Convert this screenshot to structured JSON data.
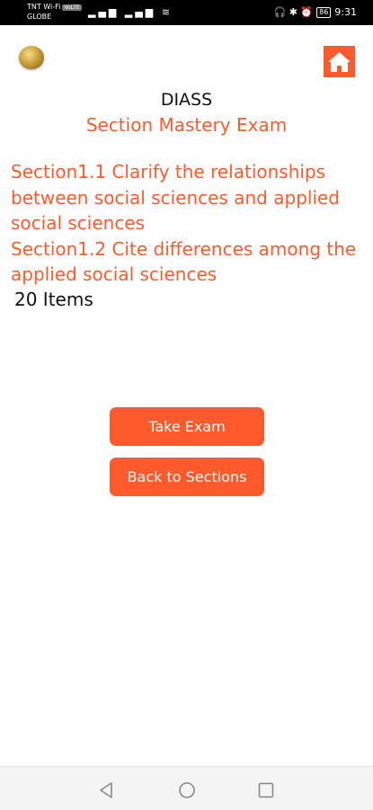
{
  "status_bar": {
    "carrier_line1": "TNT Wi-Fi",
    "carrier_badge": "VoLTE",
    "carrier_line2": "GLOBE",
    "left_icons": "▂▄▆ ▂▄▆ ≋",
    "right_icons": "🎧 ✱ ⏰",
    "battery": "86",
    "time": "9:31"
  },
  "header": {
    "logo_icon": "gold-coin-logo",
    "home_icon": "home-icon",
    "subject": "DIASS",
    "exam_title": "Section Mastery Exam"
  },
  "sections": [
    "Section1.1 Clarify the relationships between social sciences and applied social sciences",
    "Section1.2 Cite differences among the applied social sciences"
  ],
  "items_count": "20 Items",
  "buttons": {
    "take_exam": "Take Exam",
    "back_to_sections": "Back to Sections"
  },
  "nav_bar": {
    "back_icon": "triangle-back-icon",
    "home_icon": "circle-home-icon",
    "recent_icon": "square-recent-icon"
  },
  "colors": {
    "accent": "#ff5a2c",
    "text": "#111111",
    "background": "#ffffff"
  }
}
